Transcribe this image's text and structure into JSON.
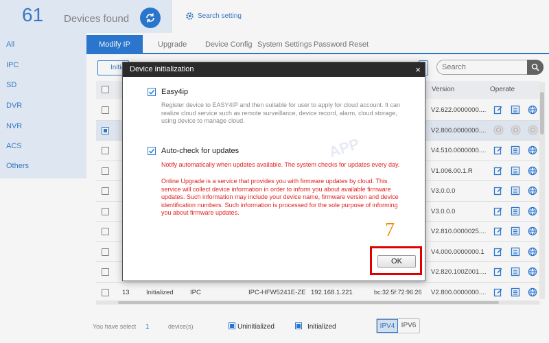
{
  "header": {
    "device_count": "61",
    "devices_found_label": "Devices found",
    "search_setting_label": "Search setting"
  },
  "sidebar": {
    "items": [
      {
        "label": "All"
      },
      {
        "label": "IPC"
      },
      {
        "label": "SD"
      },
      {
        "label": "DVR"
      },
      {
        "label": "NVR"
      },
      {
        "label": "ACS"
      },
      {
        "label": "Others"
      }
    ]
  },
  "tabs": [
    {
      "label": "Modify IP",
      "active": true
    },
    {
      "label": "Upgrade"
    },
    {
      "label": "Device Config"
    },
    {
      "label": "System Settings"
    },
    {
      "label": "Password Reset"
    }
  ],
  "toolbar": {
    "first_button_label": "Initia",
    "search_placeholder": "Search"
  },
  "table": {
    "headers": {
      "version": "Version",
      "operate": "Operate"
    },
    "rows": [
      {
        "version": "V2.622.0000000....",
        "checked": false,
        "ops_disabled": false
      },
      {
        "version": "V2.800.0000000....",
        "checked": true,
        "ops_disabled": true
      },
      {
        "version": "V4.510.0000000....",
        "checked": false,
        "ops_disabled": false
      },
      {
        "version": "V1.006.00.1.R",
        "checked": false,
        "ops_disabled": false
      },
      {
        "version": "V3.0.0.0",
        "checked": false,
        "ops_disabled": false
      },
      {
        "version": "V3.0.0.0",
        "checked": false,
        "ops_disabled": false
      },
      {
        "version": "V2.810.0000025....",
        "checked": false,
        "ops_disabled": false
      },
      {
        "version": "V4.000.0000000.1",
        "checked": false,
        "ops_disabled": false
      },
      {
        "version": "V2.820.100Z001....",
        "checked": false,
        "ops_disabled": false
      },
      {
        "number": "13",
        "status": "Initialized",
        "type": "IPC",
        "model": "IPC-HFW5241E-ZE",
        "ip": "192.168.1.221",
        "mac": "bc:32:5f:72:96:26",
        "version": "V2.800.0000000....",
        "checked": false,
        "ops_disabled": false
      }
    ]
  },
  "footer": {
    "you_have_select": "You have select",
    "selected_count": "1",
    "devices_label": "device(s)",
    "legend_uninitialized": "Uninitialized",
    "legend_initialized": "Initialized",
    "ipv4": "IPV4",
    "ipv6": "IPV6"
  },
  "dialog": {
    "title": "Device initialization",
    "close_glyph": "×",
    "option1": {
      "title": "Easy4ip",
      "checked": true,
      "description": "Register device to EASY4IP and then suitable for user to apply for cloud account. It can realize cloud service such as remote surveillance, device record, alarm, cloud storage, using device to manage cloud."
    },
    "option2": {
      "title": "Auto-check for updates",
      "checked": true,
      "notice": "Notify automatically when updates available. The system checks for updates every day.",
      "online_upgrade": "Online Upgrade is a service that provides you with firmware updates by cloud. This service will collect device information in order to inform you about available firmware updates. Such information may include your device name, firmware version and device identification numbers. Such information is processed for the sole purpose of informing you about firmware updates."
    },
    "watermark": "APP",
    "ok_label": "OK",
    "step_number": "7"
  },
  "colors": {
    "accent": "#2d7bd6",
    "highlight_red": "#e00000",
    "step_orange": "#f08a00",
    "notice_red": "#e02020"
  }
}
